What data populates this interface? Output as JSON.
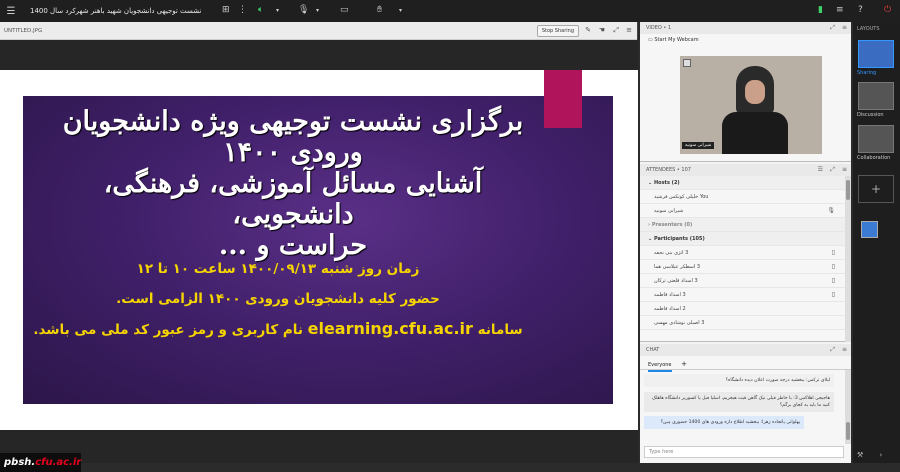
{
  "topbar": {
    "menu_icon": "menu-icon",
    "title": "نشست توجیهی دانشجویان شهید باهنر شهرکرد سال 1400",
    "icons": [
      "grid-icon",
      "more-icon",
      "speaker-icon",
      "chevron-down-icon",
      "microphone-icon",
      "webcam-icon",
      "raise-hand-icon",
      "signal-icon",
      "settings-icon",
      "help-icon",
      "power-icon"
    ]
  },
  "share_pod": {
    "file_name": "UNTITLED.JPG",
    "stop_sharing_label": "Stop Sharing"
  },
  "slide": {
    "title_lines": [
      "برگزاری نشست توجیهی ویژه دانشجویان",
      "ورودی ۱۴۰۰",
      "آشنایی مسائل آموزشی، فرهنگی، دانشجویی،",
      "حراست و ..."
    ],
    "line1": "زمان روز شنبه ۱۴۰۰/۰۹/۱۳ ساعت ۱۰ تا ۱۲",
    "line2": "حضور کلیه دانشجویان ورودی ۱۴۰۰ الزامی است.",
    "line3_prefix": "سامانه",
    "line3_url": "elearning.cfu.ac.ir",
    "line3_suffix": "نام کاربری و رمز عبور کد ملی می باشد."
  },
  "brand": {
    "prefix": "pbsh.",
    "domain": "cfu.ac.ir"
  },
  "video_pod": {
    "header": "VIDEO • 1",
    "start_webcam_label": "Start My Webcam",
    "participant_name": "شیرانی سونیه"
  },
  "attendees_pod": {
    "header": "ATTENDEES • 107",
    "hosts_label": "Hosts (2)",
    "hosts": [
      {
        "name": "You خلیلی کوتکس فرشید",
        "device": ""
      },
      {
        "name": "شیرانی سونیه",
        "device": "mic"
      }
    ],
    "presenters_label": "Presenters (0)",
    "participants_label": "Participants (105)",
    "participants": [
      {
        "name": "3 اتژی بنی نجفه",
        "device": "phone"
      },
      {
        "name": "3 اسطکر عیلاسی هما",
        "device": "phone"
      },
      {
        "name": "3 اسداد قلعتی ترکان",
        "device": "phone"
      },
      {
        "name": "3 اسداد فاطمه",
        "device": "phone"
      },
      {
        "name": "2 اسداد فاطمه",
        "device": ""
      },
      {
        "name": "3 اصیلی نوشادی مهسی",
        "device": ""
      }
    ]
  },
  "chat_pod": {
    "header": "CHAT",
    "tab_label": "Everyone",
    "messages": [
      "لیلای ترکس: ببخشید درجه صورت اعلان دیده دانشگاه؟",
      "هاجیجی اهلاکس 3: با خاطر فیلی نیک گاهن قیت هیخریم، اسلیا فیل یا کسوریر دانشگاه هاهلک کنید ما باید به کجای برگم؟",
      "پهلوانی پاتجاده زهرا: ببخشید اطلاع داره ورودی های 1400 حضوری ہین؟"
    ],
    "input_placeholder": "Type here"
  },
  "layouts": {
    "header": "LAYOUTS",
    "items": [
      {
        "label": "Sharing",
        "active": true
      },
      {
        "label": "Discussion",
        "active": false
      },
      {
        "label": "Collaboration",
        "active": false
      }
    ],
    "add_symbol": "+"
  },
  "colors": {
    "slide_purple": "#3f1f68",
    "ribbon": "#b0155c",
    "slide_yellow": "#f5d400",
    "accent_blue": "#3399ff",
    "mic_green": "#3dd16b",
    "end_red": "#e04040"
  }
}
